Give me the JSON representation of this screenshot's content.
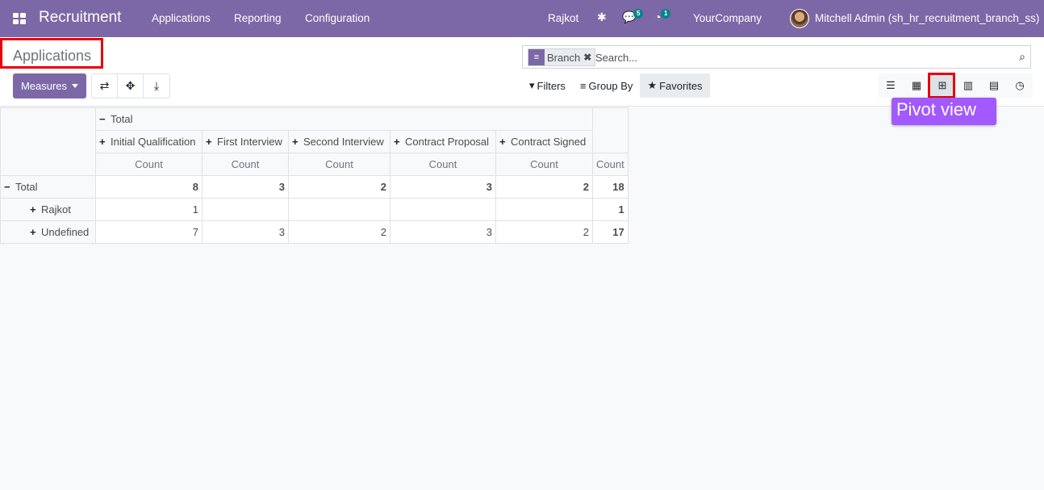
{
  "navbar": {
    "app_title": "Recruitment",
    "menu": [
      "Applications",
      "Reporting",
      "Configuration"
    ],
    "branch": "Rajkot",
    "messages_count": "5",
    "activities_count": "1",
    "company": "YourCompany",
    "user": "Mitchell Admin (sh_hr_recruitment_branch_ss)"
  },
  "breadcrumb": "Applications",
  "toolbar": {
    "measures_label": "Measures"
  },
  "search": {
    "facet_label": "Branch",
    "placeholder": "Search..."
  },
  "filters": {
    "filters_label": "Filters",
    "group_by_label": "Group By",
    "favorites_label": "Favorites"
  },
  "tooltip": "Pivot view",
  "pivot": {
    "col_total_label": "Total",
    "stages": [
      "Initial Qualification",
      "First Interview",
      "Second Interview",
      "Contract Proposal",
      "Contract Signed"
    ],
    "measure": "Count",
    "rows": [
      {
        "label": "Total",
        "values": [
          "8",
          "3",
          "2",
          "3",
          "2"
        ],
        "total": "18"
      },
      {
        "label": "Rajkot",
        "values": [
          "1",
          "",
          "",
          "",
          ""
        ],
        "total": "1"
      },
      {
        "label": "Undefined",
        "values": [
          "7",
          "3",
          "2",
          "3",
          "2"
        ],
        "total": "17"
      }
    ]
  }
}
